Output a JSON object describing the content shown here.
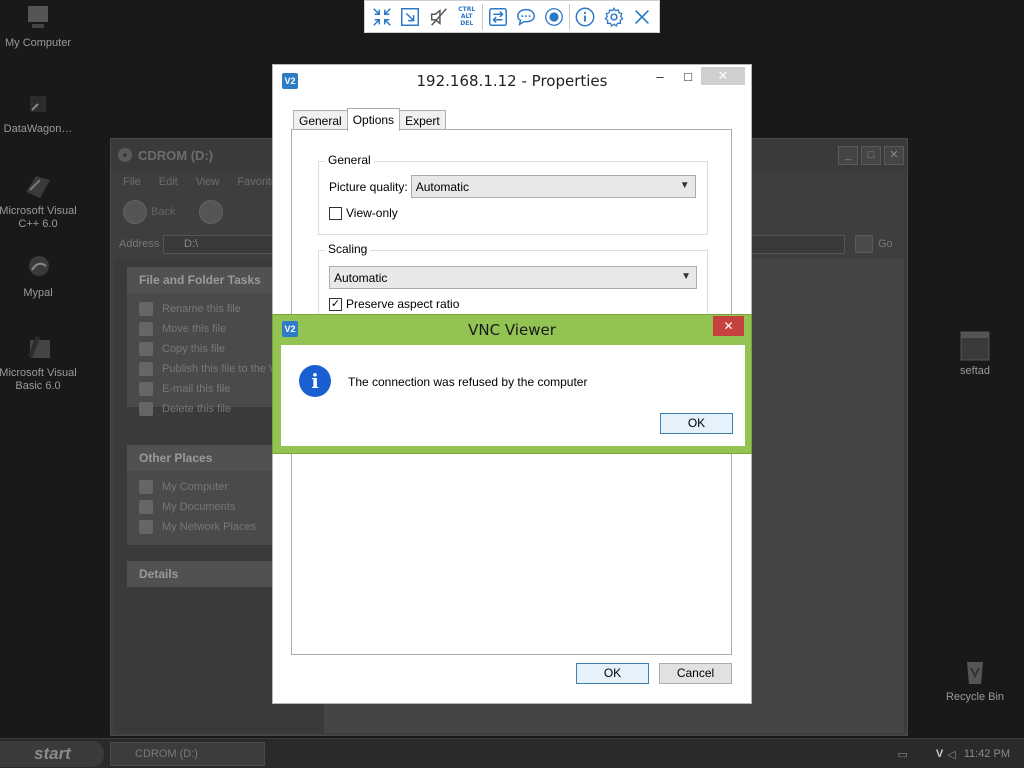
{
  "desktop": {
    "icons": [
      {
        "label": "My Computer"
      },
      {
        "label": "DataWagon…"
      },
      {
        "label": "Microsoft Visual C++ 6.0"
      },
      {
        "label": "Mypal"
      },
      {
        "label": "Microsoft Visual Basic 6.0"
      },
      {
        "label": "seftad"
      },
      {
        "label": "Recycle Bin"
      }
    ]
  },
  "vnc_toolbar": {
    "ctrl_alt_del_label": "CTRL ALT DEL"
  },
  "explorer": {
    "title": "CDROM (D:)",
    "menu": [
      "File",
      "Edit",
      "View",
      "Favorites"
    ],
    "back_label": "Back",
    "address_label": "Address",
    "address_value": "D:\\",
    "go_label": "Go",
    "file_tasks": {
      "title": "File and Folder Tasks",
      "items": [
        "Rename this file",
        "Move this file",
        "Copy this file",
        "Publish this file to the Web",
        "E-mail this file",
        "Delete this file"
      ]
    },
    "other_places": {
      "title": "Other Places",
      "items": [
        "My Computer",
        "My Documents",
        "My Network Places"
      ]
    },
    "details": {
      "title": "Details"
    }
  },
  "properties": {
    "title": "192.168.1.12 - Properties",
    "tabs": [
      "General",
      "Options",
      "Expert"
    ],
    "active_tab": "Options",
    "general_group": {
      "title": "General",
      "picture_quality_label": "Picture quality:",
      "picture_quality_value": "Automatic",
      "view_only_label": "View-only",
      "view_only_checked": false
    },
    "scaling_group": {
      "title": "Scaling",
      "value": "Automatic",
      "preserve_label": "Preserve aspect ratio",
      "preserve_checked": true
    },
    "ok_label": "OK",
    "cancel_label": "Cancel"
  },
  "error_dialog": {
    "title": "VNC Viewer",
    "message": "The connection was refused by the computer",
    "ok_label": "OK",
    "accent_color": "#92c353"
  },
  "taskbar": {
    "start_label": "start",
    "task_label": "CDROM (D:)",
    "clock": "11:42 PM"
  }
}
